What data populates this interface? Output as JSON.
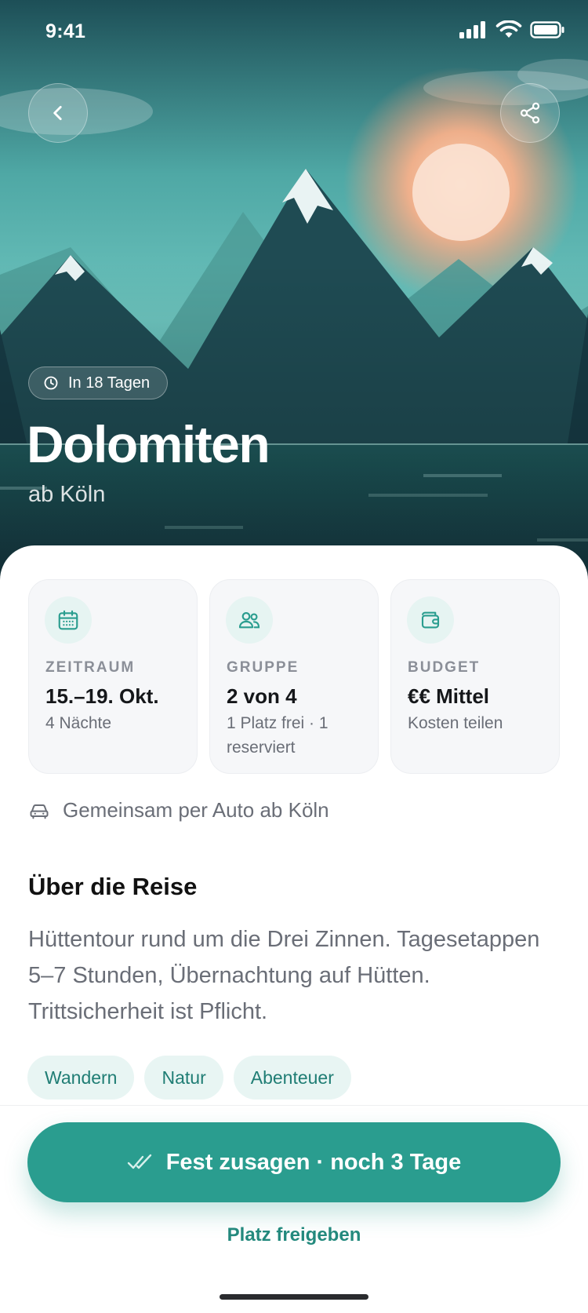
{
  "status_bar": {
    "time": "9:41",
    "signal_icon": "signal-icon",
    "wifi_icon": "wifi-icon",
    "battery_icon": "battery-icon"
  },
  "header": {
    "back_icon": "chevron-left-icon",
    "share_icon": "share-icon"
  },
  "hero": {
    "countdown_icon": "clock-icon",
    "countdown": "In 18 Tagen",
    "title": "Dolomiten",
    "subtitle": "ab Köln"
  },
  "info_cards": [
    {
      "icon": "calendar-icon",
      "label": "ZEITRAUM",
      "value": "15.–19. Okt.",
      "sub": "4 Nächte"
    },
    {
      "icon": "users-icon",
      "label": "GRUPPE",
      "value": "2 von 4",
      "sub": "1 Platz frei · 1 reserviert"
    },
    {
      "icon": "wallet-icon",
      "label": "BUDGET",
      "value": "€€ Mittel",
      "sub": "Kosten teilen"
    }
  ],
  "transport": {
    "icon": "car-icon",
    "text": "Gemeinsam per Auto ab Köln"
  },
  "about": {
    "title": "Über die Reise",
    "text": "Hüttentour rund um die Drei Zinnen. Tagesetappen 5–7 Stunden, Übernachtung auf Hütten. Trittsicherheit ist Pflicht."
  },
  "tags": [
    "Wandern",
    "Natur",
    "Abenteuer"
  ],
  "actions": {
    "primary_icon": "double-check-icon",
    "primary": "Fest zusagen · noch 3 Tage",
    "secondary": "Platz freigeben"
  },
  "colors": {
    "accent": "#2a9d8f",
    "accent_text": "#1f7d74",
    "tag_bg": "#e8f5f3",
    "sky": "#5fb8b3",
    "mountain_dark": "#1f4a52"
  }
}
